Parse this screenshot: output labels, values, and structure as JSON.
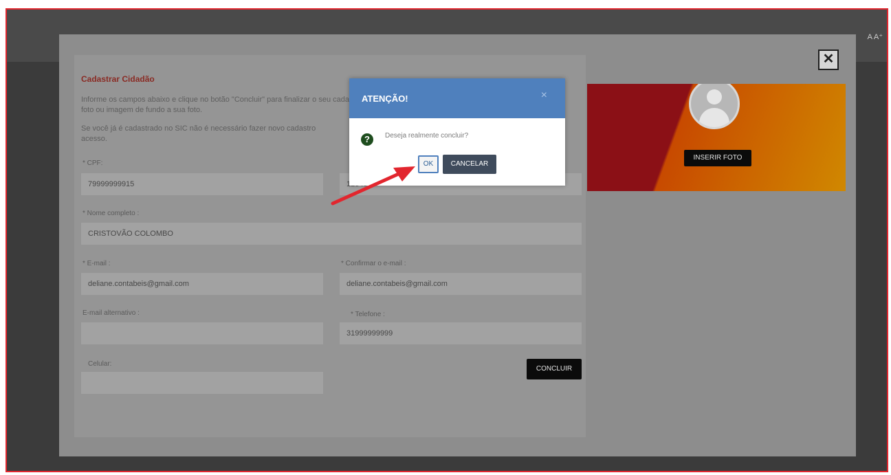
{
  "page": {
    "font_controls": "A A⁺"
  },
  "form": {
    "title": "Cadastrar Cidadão",
    "intro_line1": "Informe os campos abaixo e clique no botão \"Concluir\" para finalizar o seu cadastro",
    "intro_line2": "foto ou imagem de fundo a sua foto.",
    "intro_line3": "Se você já é cadastrado no SIC não é necessário fazer novo cadastro",
    "intro_line4": "acesso.",
    "cpf_label": "* CPF:",
    "cpf_value": "79999999915",
    "senha_value": "123456",
    "nome_label": "* Nome completo :",
    "nome_value": "CRISTOVÃO COLOMBO",
    "email_label": "* E-mail :",
    "email_value": "deliane.contabeis@gmail.com",
    "confirm_email_label": "* Confirmar o e-mail :",
    "confirm_email_value": "deliane.contabeis@gmail.com",
    "alt_email_label": "E-mail alternativo :",
    "alt_email_value": "",
    "telefone_label": "* Telefone :",
    "telefone_value": "31999999999",
    "celular_label": "Celular:",
    "celular_value": "",
    "concluir_label": "CONCLUIR"
  },
  "photo": {
    "insert_label": "INSERIR FOTO"
  },
  "modal": {
    "close_symbol": "✕"
  },
  "dialog": {
    "title": "ATENÇÃO!",
    "close_symbol": "×",
    "question_symbol": "?",
    "message": "Deseja realmente concluir?",
    "ok_label": "OK",
    "cancel_label": "CANCELAR"
  },
  "colors": {
    "dialog_header": "#4f80bd",
    "arrow": "#e2262e",
    "frame_border": "#e2262e"
  }
}
